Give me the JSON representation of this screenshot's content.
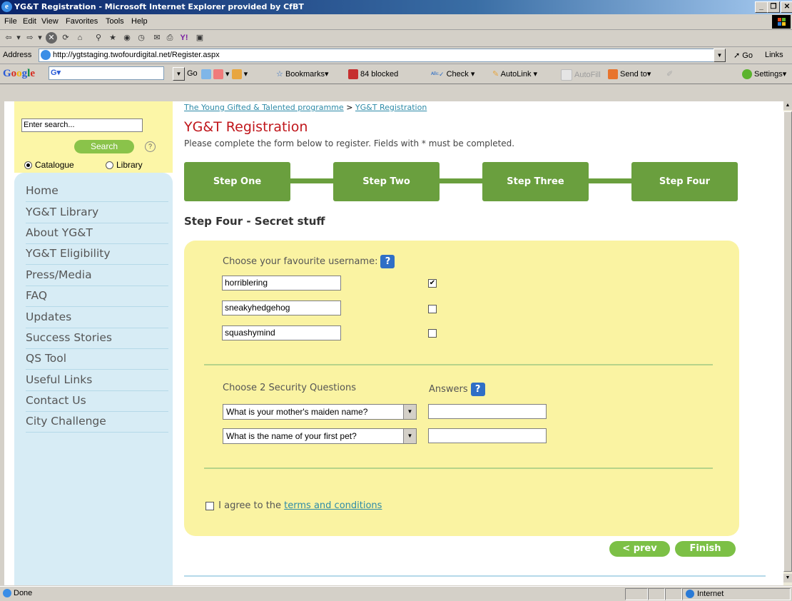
{
  "window": {
    "title": "YG&T Registration - Microsoft Internet Explorer provided by CfBT",
    "minimize": "_",
    "restore": "❐",
    "close": "✕"
  },
  "menubar": [
    "File",
    "Edit",
    "View",
    "Favorites",
    "Tools",
    "Help"
  ],
  "address": {
    "label": "Address",
    "url": "http://ygtstaging.twofourdigital.net/Register.aspx",
    "go": "Go",
    "links": "Links"
  },
  "googlebar": {
    "logo": "Google",
    "g_label": "G▾",
    "go": "Go",
    "bookmarks": "Bookmarks▾",
    "blocked": "84 blocked",
    "check": "Check ▾",
    "autolink": "AutoLink ▾",
    "autofill": "AutoFill",
    "sendto": "Send to▾",
    "settings": "Settings▾"
  },
  "sidebar": {
    "search_placeholder": "Enter search...",
    "search_button": "Search",
    "help": "?",
    "radio_catalogue": "Catalogue",
    "radio_library": "Library",
    "selected_radio": "Catalogue",
    "nav": [
      "Home",
      "YG&T Library",
      "About YG&T",
      "YG&T Eligibility",
      "Press/Media",
      "FAQ",
      "Updates",
      "Success Stories",
      "QS Tool",
      "Useful Links",
      "Contact Us",
      "City Challenge"
    ]
  },
  "breadcrumb": {
    "home": "The Young Gifted & Talented programme",
    "sep": ">",
    "current": "YG&T Registration"
  },
  "main": {
    "title": "YG&T Registration",
    "subtitle": "Please complete the form below to register. Fields with * must be completed.",
    "steps": [
      "Step One",
      "Step Two",
      "Step Three",
      "Step Four"
    ],
    "step_heading": "Step Four - Secret stuff",
    "username_label": "Choose your favourite username:",
    "usernames": [
      {
        "value": "horriblering",
        "checked": true,
        "mark": "✔"
      },
      {
        "value": "sneakyhedgehog",
        "checked": false,
        "mark": ""
      },
      {
        "value": "squashymind",
        "checked": false,
        "mark": ""
      }
    ],
    "security_label": "Choose 2 Security Questions",
    "answers_label": "Answers",
    "questions": [
      "What is your mother's maiden name?",
      "What is the name of your first pet?"
    ],
    "agree_prefix": "I agree to the",
    "agree_link": "terms and conditions",
    "prev_button": "< prev",
    "finish_button": "Finish",
    "help_icon": "?"
  },
  "status": {
    "text": "Done",
    "zone": "Internet"
  },
  "colors": {
    "step_green": "#6a9f3e",
    "button_green": "#7cc046",
    "title_red": "#c0161b",
    "panel_yellow": "#faf3a2",
    "nav_blue": "#d7ecf5",
    "link_teal": "#2e8ba8"
  }
}
